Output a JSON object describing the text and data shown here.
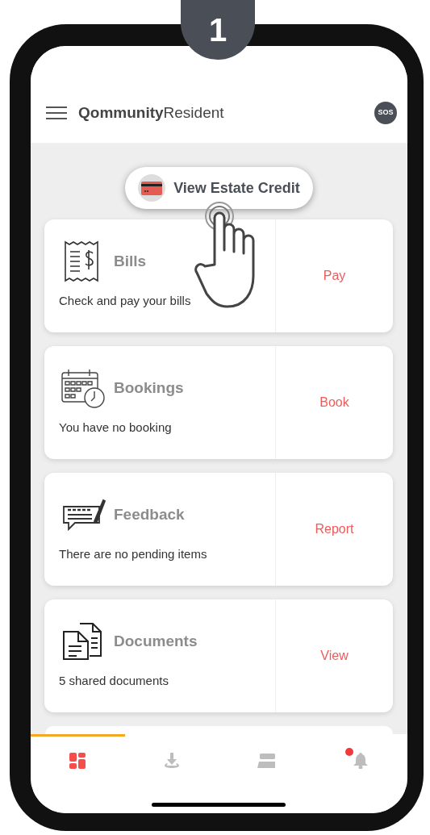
{
  "step_badge": "1",
  "app_bar": {
    "title_bold": "Qommunity",
    "title_regular": "Resident",
    "sos": "SOS"
  },
  "credit_button": {
    "label": "View Estate Credit"
  },
  "cards": [
    {
      "kind": "bills",
      "title": "Bills",
      "description": "Check and pay your bills",
      "action": "Pay"
    },
    {
      "kind": "bookings",
      "title": "Bookings",
      "description": "You have no booking",
      "action": "Book"
    },
    {
      "kind": "feedback",
      "title": "Feedback",
      "description": "There are no pending items",
      "action": "Report"
    },
    {
      "kind": "documents",
      "title": "Documents",
      "description": "5 shared documents",
      "action": "View"
    }
  ],
  "bottom_nav": [
    {
      "kind": "dashboard",
      "selected": true,
      "notification": false
    },
    {
      "kind": "download",
      "selected": false,
      "notification": false
    },
    {
      "kind": "stack",
      "selected": false,
      "notification": false
    },
    {
      "kind": "bell",
      "selected": false,
      "notification": true
    }
  ]
}
